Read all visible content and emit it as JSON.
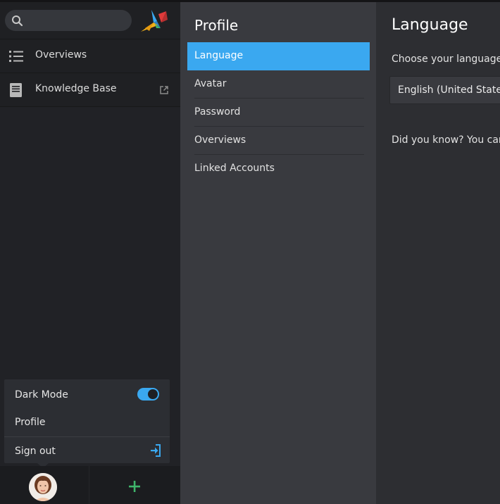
{
  "sidebar": {
    "search": {
      "value": "",
      "placeholder": ""
    },
    "nav_items": [
      {
        "label": "Overviews",
        "icon": "list-icon"
      },
      {
        "label": "Knowledge Base",
        "icon": "book-icon"
      }
    ],
    "user_menu": {
      "dark_mode_label": "Dark Mode",
      "dark_mode_on": true,
      "profile_label": "Profile",
      "sign_out_label": "Sign out"
    }
  },
  "settings": {
    "title": "Profile",
    "items": [
      {
        "label": "Language",
        "active": true
      },
      {
        "label": "Avatar",
        "active": false
      },
      {
        "label": "Password",
        "active": false
      },
      {
        "label": "Overviews",
        "active": false
      },
      {
        "label": "Linked Accounts",
        "active": false
      }
    ]
  },
  "content": {
    "title": "Language",
    "description": "Choose your language.",
    "selected_language": "English (United States)",
    "tip": "Did you know? You can h"
  },
  "colors": {
    "accent": "#3aa8f0",
    "add_button": "#3fb56b",
    "sidebar_bg": "#212226",
    "settings_bg": "#393a3f",
    "content_bg": "#2d2e32"
  }
}
